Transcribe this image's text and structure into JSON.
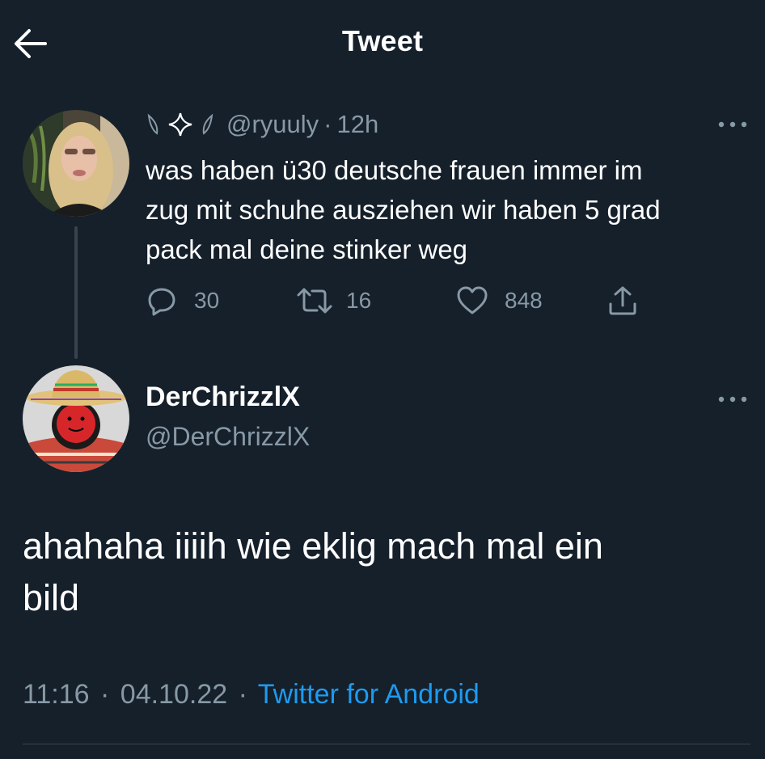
{
  "header": {
    "title": "Tweet",
    "back_icon": "arrow-left-icon"
  },
  "parent_tweet": {
    "display_name_icons": [
      "moon-icon",
      "sparkle-icon",
      "moon-icon"
    ],
    "handle": "@ryuuly",
    "separator": "·",
    "time": "12h",
    "text_lines": [
      "was haben ü30 deutsche frauen immer im",
      "zug mit schuhe ausziehen wir haben 5 grad",
      "pack mal deine stinker weg"
    ],
    "actions": {
      "replies": "30",
      "retweets": "16",
      "likes": "848"
    },
    "more_icon": "more-horizontal-icon"
  },
  "main_tweet": {
    "name": "DerChrizzlX",
    "handle": "@DerChrizzlX",
    "text_lines": [
      "ahahaha iiiih wie eklig mach mal ein",
      "bild"
    ],
    "time": "11:16",
    "separator": "·",
    "date": "04.10.22",
    "source": "Twitter for Android",
    "more_icon": "more-horizontal-icon"
  },
  "colors": {
    "background": "#15202b",
    "text_primary": "#ffffff",
    "text_secondary": "#8899a6",
    "link": "#1d9bf0",
    "divider": "#38444d"
  }
}
